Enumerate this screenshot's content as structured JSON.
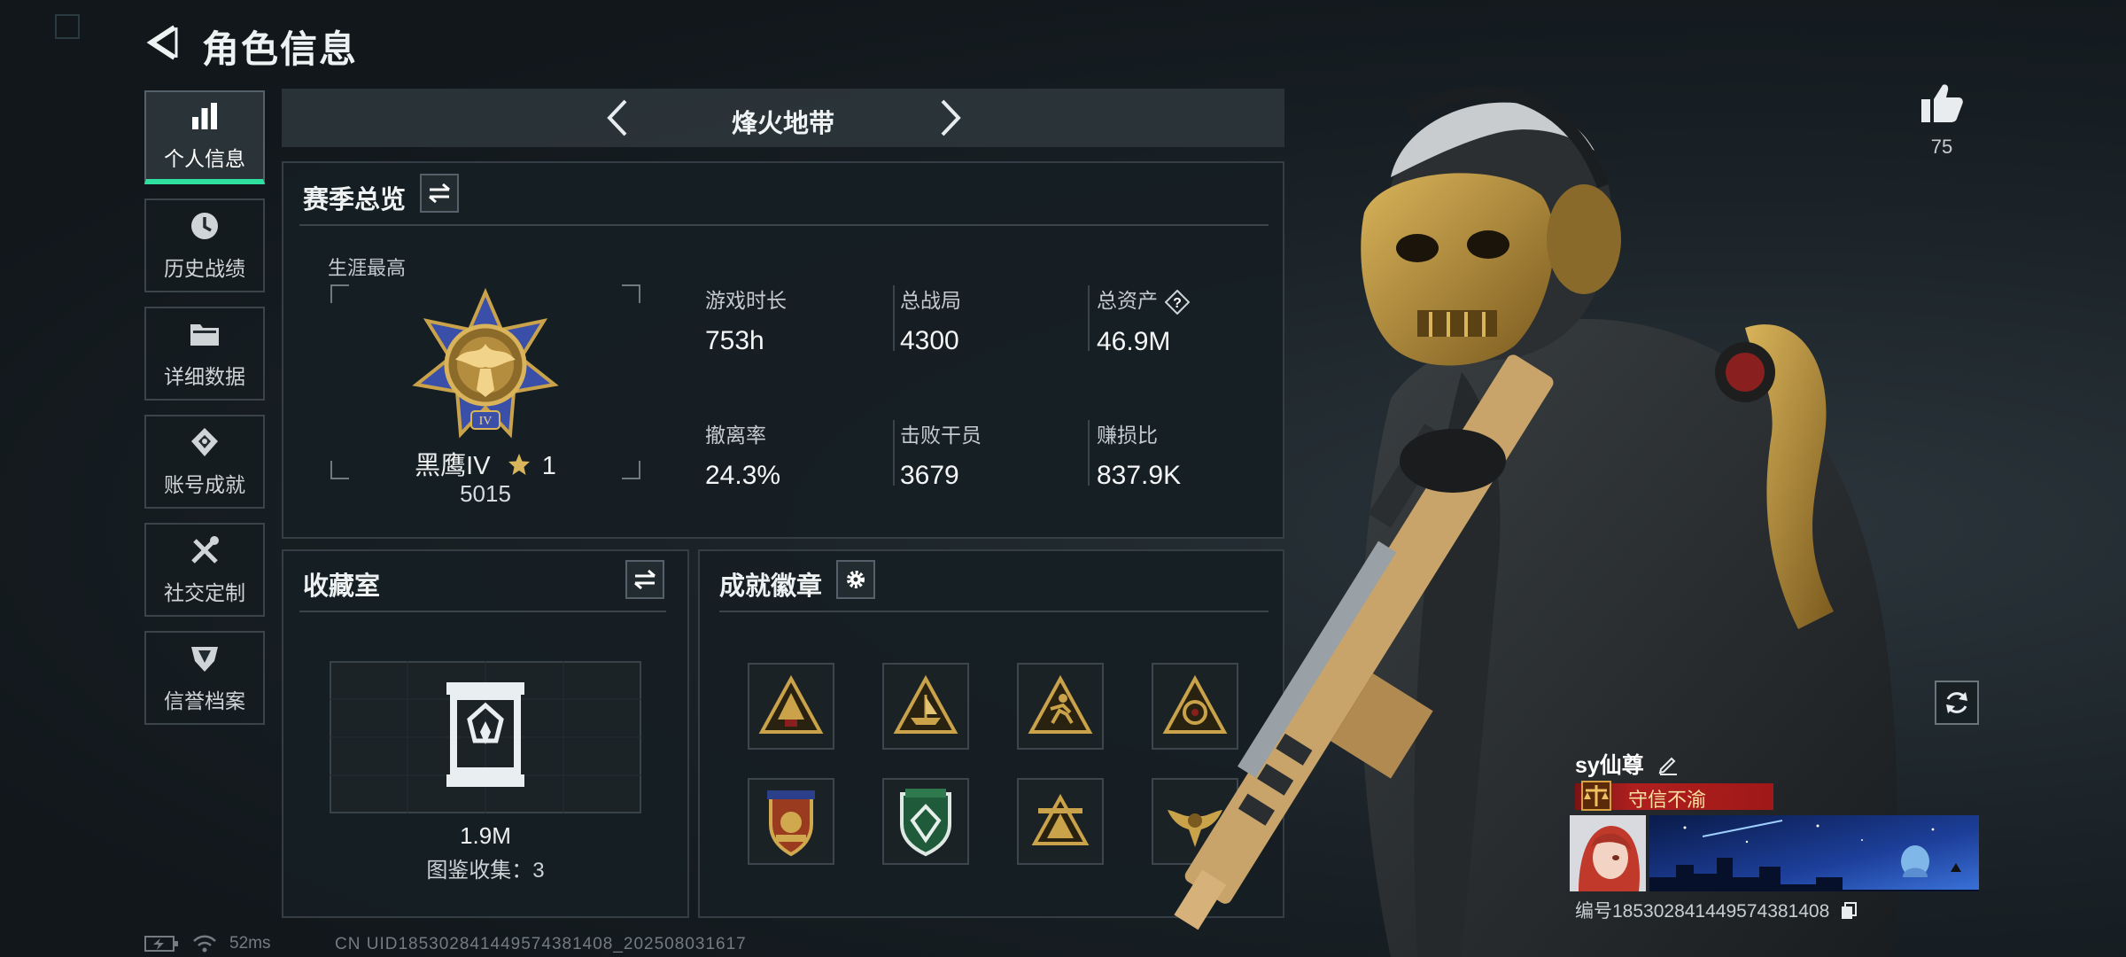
{
  "header": {
    "title": "角色信息"
  },
  "nav": {
    "items": [
      {
        "label": "个人信息",
        "icon": "bar-chart-icon",
        "active": true
      },
      {
        "label": "历史战绩",
        "icon": "clock-icon"
      },
      {
        "label": "详细数据",
        "icon": "folder-icon"
      },
      {
        "label": "账号成就",
        "icon": "medal-icon"
      },
      {
        "label": "社交定制",
        "icon": "tools-icon"
      },
      {
        "label": "信誉档案",
        "icon": "shield-icon"
      }
    ]
  },
  "mode": {
    "title": "烽火地带"
  },
  "season": {
    "title": "赛季总览",
    "career_label": "生涯最高",
    "rank_name": "黑鹰IV",
    "rank_stars": "1",
    "rank_score": "5015",
    "stats": [
      {
        "label": "游戏时长",
        "value": "753h"
      },
      {
        "label": "总战局",
        "value": "4300"
      },
      {
        "label": "总资产",
        "value": "46.9M"
      },
      {
        "label": "撤离率",
        "value": "24.3%"
      },
      {
        "label": "击败干员",
        "value": "3679"
      },
      {
        "label": "赚损比",
        "value": "837.9K"
      }
    ]
  },
  "collection": {
    "title": "收藏室",
    "value": "1.9M",
    "count_text": "图鉴收集：3"
  },
  "achievements": {
    "title": "成就徽章",
    "badges": [
      "triangle-gold",
      "triangle-ship",
      "triangle-runner",
      "triangle-emblem",
      "crest-red",
      "shield-green",
      "tent-gold",
      "eagle-gold"
    ]
  },
  "likes": {
    "count": "75"
  },
  "player": {
    "name": "sy仙尊",
    "title": "守信不渝",
    "id_text": "编号18530284144957438140​8"
  },
  "status": {
    "ping": "52ms",
    "uid": "CN UID18530284144957438140​8_202508031617"
  },
  "colors": {
    "accent": "#2fe0a0",
    "gold": "#c9a24a",
    "title_red": "#b01f1f"
  }
}
